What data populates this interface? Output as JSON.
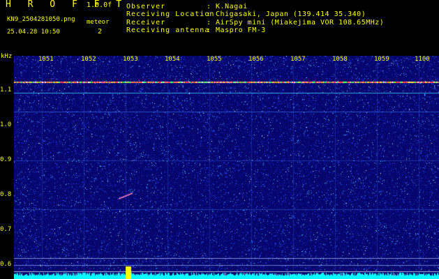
{
  "header": {
    "app_title": "H R O F F T",
    "version": "1.0.0f",
    "file_name": "KN9_2504281050.png",
    "meteor_label": "meteor",
    "meteor_count": "2",
    "timestamp": "25.04.28 10:50",
    "fields": [
      {
        "label": "Observer",
        "value": ": K.Nagai"
      },
      {
        "label": "Receiving Location",
        "value": ": Chigasaki, Japan (139.414 35.340)"
      },
      {
        "label": "Receiver",
        "value": ": AirSpy mini (Miakejima VOR 108.65MHz)"
      },
      {
        "label": "Receiving antenna",
        "value": ": Maspro FM-3"
      }
    ]
  },
  "axis": {
    "unit_label": "kHz",
    "time_ticks": [
      "1051",
      "1052",
      "1053",
      "1054",
      "1055",
      "1056",
      "1057",
      "1058",
      "1059",
      "1100"
    ],
    "freq_ticks": [
      "1.1",
      "1.0",
      "0.9",
      "0.8",
      "0.7",
      "0.6"
    ]
  },
  "colors": {
    "text": "#ffff00",
    "background": "#000000",
    "waterfall_bg": "#0a0a8a",
    "noise_bar": "#00ffff",
    "meteor_spike": "#ffff00"
  }
}
